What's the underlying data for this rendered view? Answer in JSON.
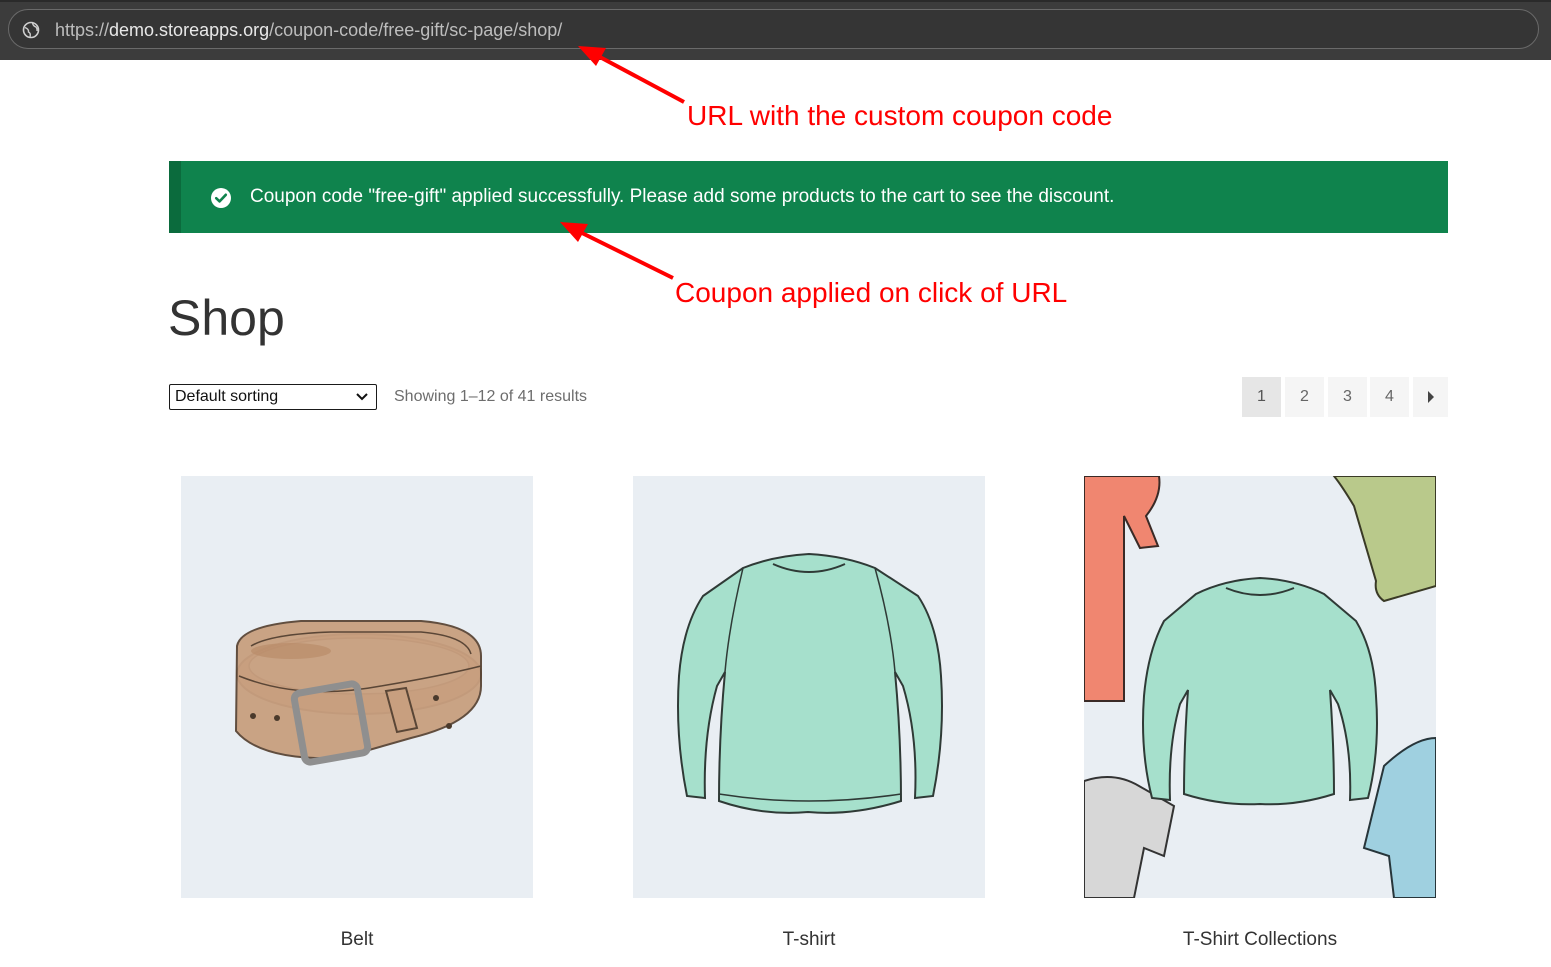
{
  "browser": {
    "url_prefix": "https://",
    "url_host": "demo.storeapps.org",
    "url_path": "/coupon-code/free-gift/sc-page/shop/"
  },
  "annotations": {
    "url_note": "URL with the custom coupon code",
    "coupon_note": "Coupon applied on click of URL",
    "color": "#ff0000"
  },
  "notice": {
    "text": "Coupon code \"free-gift\" applied successfully. Please add some products to the cart to see the discount.",
    "icon": "check-circle-icon",
    "color": "#0f834d"
  },
  "page": {
    "title": "Shop"
  },
  "toolbar": {
    "sort_selected": "Default sorting",
    "result_count": "Showing 1–12 of 41 results"
  },
  "pagination": {
    "pages": [
      "1",
      "2",
      "3",
      "4"
    ],
    "current": "1",
    "next_icon": "caret-right-icon"
  },
  "products": [
    {
      "name": "Belt",
      "image": "belt-illustration"
    },
    {
      "name": "T-shirt",
      "image": "longsleeve-shirt-illustration"
    },
    {
      "name": "T-Shirt Collections",
      "image": "shirt-collection-illustration"
    }
  ]
}
